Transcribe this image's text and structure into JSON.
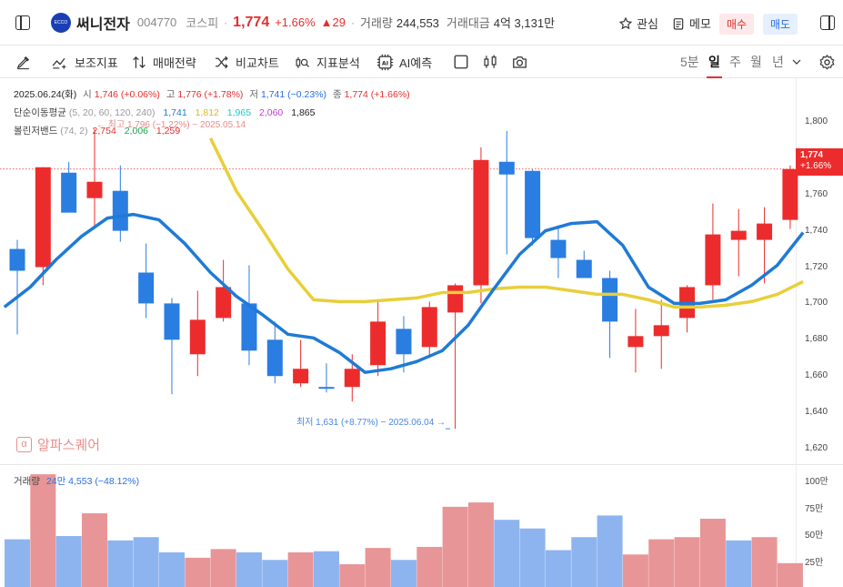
{
  "header": {
    "logo_text": "ECCO",
    "name": "써니전자",
    "code": "004770",
    "market": "코스피",
    "price": "1,774",
    "change_pct": "+1.66%",
    "change_abs": "29",
    "volume_label": "거래량",
    "volume": "244,553",
    "amount_label": "거래대금",
    "amount": "4억 3,131만",
    "watch_label": "관심",
    "memo_label": "메모",
    "buy_label": "매수",
    "sell_label": "매도"
  },
  "toolbar": {
    "indicator_label": "보조지표",
    "strategy_label": "매매전략",
    "compare_label": "비교차트",
    "analysis_label": "지표분석",
    "ai_label": "AI예측",
    "periods": [
      "5분",
      "일",
      "주",
      "월",
      "년"
    ],
    "selected_period": "일"
  },
  "legend": {
    "date": "2025.06.24(화)",
    "open_label": "시",
    "open": "1,746 (+0.06%)",
    "high_label": "고",
    "high": "1,776 (+1.78%)",
    "low_label": "저",
    "low": "1,741 (−0.23%)",
    "close_label": "종",
    "close": "1,774 (+1.66%)",
    "ma_label": "단순이동평균",
    "ma_params": "(5, 20, 60, 120, 240)",
    "ma_values": [
      "1,741",
      "1,812",
      "1,965",
      "2,060",
      "1,865"
    ],
    "bb_label": "볼린저밴드",
    "bb_params": "(74, 2)",
    "bb_values": [
      "2,754",
      "2,006",
      "1,259"
    ],
    "high_marker": "최고 1,796 (−1.22%) − 2025.05.14",
    "low_marker": "최저 1,631 (+8.77%) − 2025.06.04 →",
    "watermark": "알파스퀘어",
    "current_price_tag": "1,774",
    "current_pct_tag": "+1.66%",
    "volume_legend_label": "거래량",
    "volume_legend_value": "24만 4,553 (−48.12%)"
  },
  "chart_data": {
    "type": "candlestick",
    "y_ticks": [
      "1,800",
      "1,780",
      "1,760",
      "1,740",
      "1,720",
      "1,700",
      "1,680",
      "1,660",
      "1,640",
      "1,620"
    ],
    "y_range": [
      1614,
      1824
    ],
    "vol_ticks": [
      "100만",
      "75만",
      "50만",
      "25만"
    ],
    "vol_range": [
      0,
      1100000
    ],
    "colors": {
      "up": "#ec2c2c",
      "down": "#2a7de1",
      "ma5": "#1f7ad6",
      "ma20": "#e8cf3a",
      "vol_up": "#e89597",
      "vol_down": "#8eb4ef"
    },
    "candles": [
      {
        "o": 1730,
        "h": 1735,
        "l": 1683,
        "c": 1718
      },
      {
        "o": 1720,
        "h": 1775,
        "l": 1710,
        "c": 1775
      },
      {
        "o": 1772,
        "h": 1778,
        "l": 1755,
        "c": 1750
      },
      {
        "o": 1758,
        "h": 1796,
        "l": 1742,
        "c": 1767
      },
      {
        "o": 1762,
        "h": 1776,
        "l": 1734,
        "c": 1740
      },
      {
        "o": 1717,
        "h": 1733,
        "l": 1692,
        "c": 1700
      },
      {
        "o": 1700,
        "h": 1703,
        "l": 1650,
        "c": 1680
      },
      {
        "o": 1672,
        "h": 1707,
        "l": 1660,
        "c": 1691
      },
      {
        "o": 1692,
        "h": 1724,
        "l": 1690,
        "c": 1709
      },
      {
        "o": 1700,
        "h": 1721,
        "l": 1666,
        "c": 1674
      },
      {
        "o": 1680,
        "h": 1690,
        "l": 1656,
        "c": 1660
      },
      {
        "o": 1656,
        "h": 1680,
        "l": 1654,
        "c": 1664
      },
      {
        "o": 1654,
        "h": 1667,
        "l": 1651,
        "c": 1653
      },
      {
        "o": 1654,
        "h": 1672,
        "l": 1646,
        "c": 1664
      },
      {
        "o": 1666,
        "h": 1701,
        "l": 1660,
        "c": 1690
      },
      {
        "o": 1686,
        "h": 1693,
        "l": 1662,
        "c": 1672
      },
      {
        "o": 1676,
        "h": 1701,
        "l": 1670,
        "c": 1698
      },
      {
        "o": 1695,
        "h": 1711,
        "l": 1631,
        "c": 1710
      },
      {
        "o": 1710,
        "h": 1786,
        "l": 1700,
        "c": 1779
      },
      {
        "o": 1778,
        "h": 1795,
        "l": 1727,
        "c": 1771
      },
      {
        "o": 1773,
        "h": 1774,
        "l": 1732,
        "c": 1736
      },
      {
        "o": 1735,
        "h": 1743,
        "l": 1714,
        "c": 1725
      },
      {
        "o": 1724,
        "h": 1729,
        "l": 1714,
        "c": 1714
      },
      {
        "o": 1714,
        "h": 1718,
        "l": 1670,
        "c": 1690
      },
      {
        "o": 1676,
        "h": 1697,
        "l": 1662,
        "c": 1682
      },
      {
        "o": 1682,
        "h": 1702,
        "l": 1664,
        "c": 1688
      },
      {
        "o": 1692,
        "h": 1710,
        "l": 1684,
        "c": 1709
      },
      {
        "o": 1710,
        "h": 1755,
        "l": 1702,
        "c": 1738
      },
      {
        "o": 1735,
        "h": 1752,
        "l": 1715,
        "c": 1740
      },
      {
        "o": 1735,
        "h": 1753,
        "l": 1711,
        "c": 1744
      },
      {
        "o": 1746,
        "h": 1776,
        "l": 1741,
        "c": 1774
      }
    ],
    "ma5": [
      1698,
      1709,
      1724,
      1737,
      1747,
      1749,
      1746,
      1733,
      1717,
      1704,
      1694,
      1683,
      1681,
      1673,
      1662,
      1664,
      1668,
      1674,
      1688,
      1708,
      1727,
      1740,
      1744,
      1745,
      1732,
      1709,
      1700,
      1700,
      1702,
      1710,
      1721,
      1739
    ],
    "ma20": [
      null,
      null,
      null,
      null,
      null,
      null,
      null,
      null,
      1791,
      1762,
      1741,
      1719,
      1702,
      1701,
      1701,
      1702,
      1703,
      1706,
      1706,
      1708,
      1709,
      1709,
      1707,
      1705,
      1705,
      1702,
      1698,
      1698,
      1699,
      1701,
      1705,
      1712
    ],
    "volumes": [
      {
        "v": 440000,
        "up": false
      },
      {
        "v": 1040000,
        "up": true
      },
      {
        "v": 470000,
        "up": false
      },
      {
        "v": 680000,
        "up": true
      },
      {
        "v": 430000,
        "up": false
      },
      {
        "v": 460000,
        "up": false
      },
      {
        "v": 320000,
        "up": false
      },
      {
        "v": 270000,
        "up": true
      },
      {
        "v": 350000,
        "up": true
      },
      {
        "v": 320000,
        "up": false
      },
      {
        "v": 250000,
        "up": false
      },
      {
        "v": 320000,
        "up": true
      },
      {
        "v": 330000,
        "up": false
      },
      {
        "v": 210000,
        "up": true
      },
      {
        "v": 360000,
        "up": true
      },
      {
        "v": 250000,
        "up": false
      },
      {
        "v": 370000,
        "up": true
      },
      {
        "v": 740000,
        "up": true
      },
      {
        "v": 780000,
        "up": true
      },
      {
        "v": 620000,
        "up": false
      },
      {
        "v": 540000,
        "up": false
      },
      {
        "v": 340000,
        "up": false
      },
      {
        "v": 460000,
        "up": false
      },
      {
        "v": 660000,
        "up": false
      },
      {
        "v": 300000,
        "up": true
      },
      {
        "v": 440000,
        "up": true
      },
      {
        "v": 460000,
        "up": true
      },
      {
        "v": 630000,
        "up": true
      },
      {
        "v": 430000,
        "up": false
      },
      {
        "v": 460000,
        "up": true
      },
      {
        "v": 220000,
        "up": true
      }
    ]
  }
}
